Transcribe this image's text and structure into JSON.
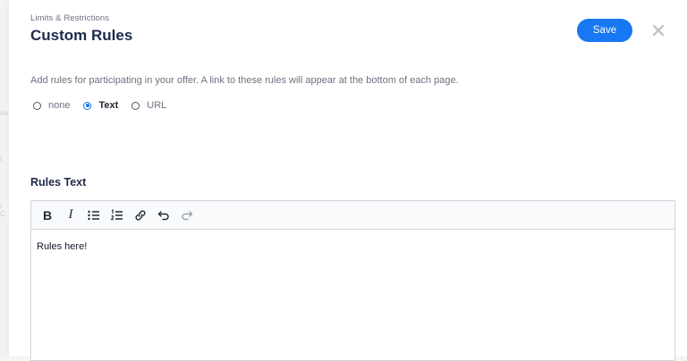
{
  "backdrop": {
    "ghost_texts": [
      "ou",
      "l.",
      "r C"
    ]
  },
  "header": {
    "breadcrumb": "Limits & Restrictions",
    "title": "Custom Rules",
    "save_label": "Save"
  },
  "description": "Add rules for participating in your offer. A link to these rules will appear at the bottom of each page.",
  "rule_type": {
    "options": [
      {
        "label": "none",
        "checked": false
      },
      {
        "label": "Text",
        "checked": true
      },
      {
        "label": "URL",
        "checked": false
      }
    ]
  },
  "rules_text": {
    "label": "Rules Text",
    "toolbar": [
      "bold-icon",
      "italic-icon",
      "bulleted-list-icon",
      "numbered-list-icon",
      "link-icon",
      "undo-icon",
      "redo-icon"
    ],
    "content": "Rules here!"
  },
  "colors": {
    "accent": "#1877f2",
    "title": "#1e2a4a",
    "muted_text": "#6b7280"
  }
}
